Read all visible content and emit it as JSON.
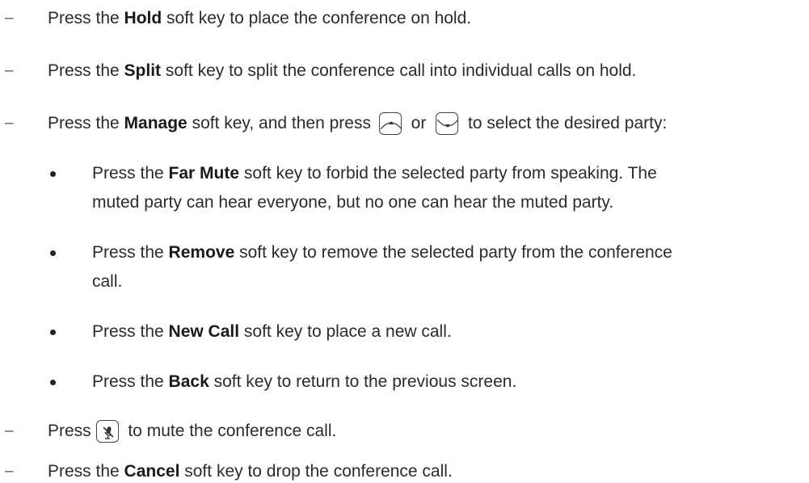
{
  "items": [
    {
      "pre": "Press the ",
      "bold": "Hold",
      "post": " soft key to place the conference on hold."
    },
    {
      "pre": "Press the ",
      "bold": "Split",
      "post": " soft key to split the conference call into individual calls on hold."
    },
    {
      "pre": "Press the ",
      "bold": "Manage",
      "post": " soft key, and then press ",
      "mid": " or ",
      "post2": " to select the desired party:"
    },
    {
      "pre": "Press the ",
      "bold": "Far Mute",
      "post": " soft key to forbid the selected party from speaking. The",
      "line2": "muted party can hear everyone, but no one can hear the muted party."
    },
    {
      "pre": "Press the ",
      "bold": "Remove",
      "post": " soft key to remove the selected party from the conference",
      "line2": "call."
    },
    {
      "pre": "Press the ",
      "bold": "New Call",
      "post": " soft key to place a new call."
    },
    {
      "pre": "Press the ",
      "bold": "Back",
      "post": " soft key to return to the previous screen."
    },
    {
      "pre": "Press ",
      "post": " to mute the conference call."
    },
    {
      "pre": "Press the ",
      "bold": "Cancel",
      "post": " soft key to drop the conference call."
    }
  ],
  "dash": "–",
  "icons": {
    "up": "up-arrow-key-icon",
    "down": "down-arrow-key-icon",
    "mute": "mute-key-icon"
  }
}
